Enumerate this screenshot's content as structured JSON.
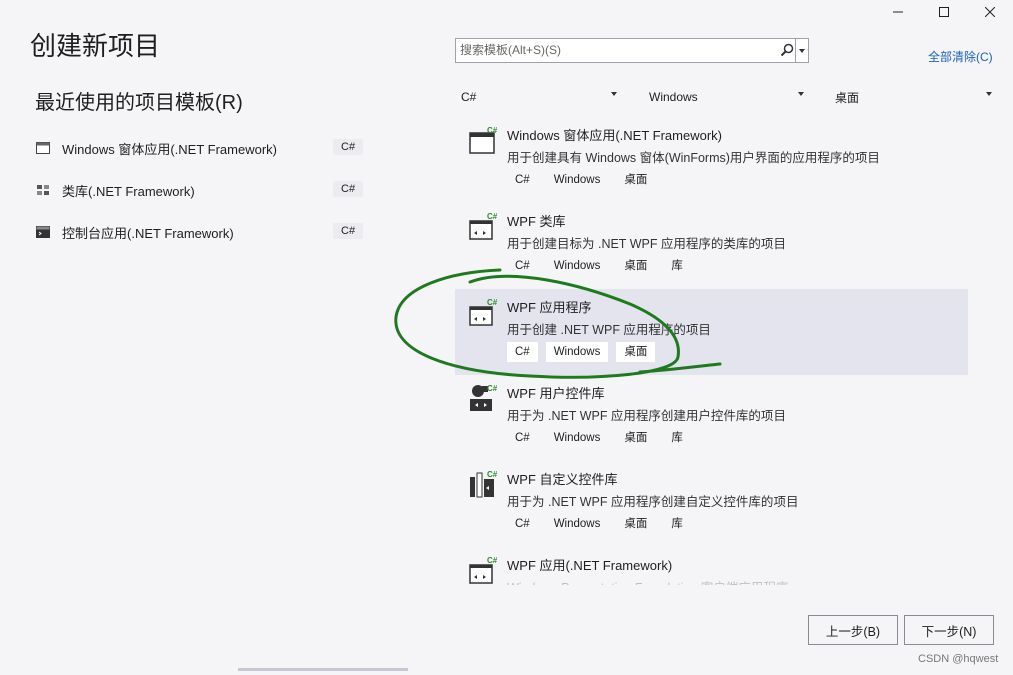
{
  "window": {
    "minimize_icon": "minimize-icon",
    "maximize_icon": "maximize-icon",
    "close_icon": "close-icon"
  },
  "page_title": "创建新项目",
  "recent": {
    "title": "最近使用的项目模板(R)",
    "items": [
      {
        "label": "Windows 窗体应用(.NET Framework)",
        "lang": "C#",
        "icon": "winforms-icon"
      },
      {
        "label": "类库(.NET Framework)",
        "lang": "C#",
        "icon": "class-library-icon"
      },
      {
        "label": "控制台应用(.NET Framework)",
        "lang": "C#",
        "icon": "console-app-icon"
      }
    ]
  },
  "search": {
    "placeholder": "搜索模板(Alt+S)(S)",
    "icon": "search-icon"
  },
  "clear_all": "全部清除(C)",
  "filters": {
    "language": "C#",
    "platform": "Windows",
    "project_type": "桌面"
  },
  "templates": [
    {
      "name": "Windows 窗体应用(.NET Framework)",
      "desc": "用于创建具有 Windows 窗体(WinForms)用户界面的应用程序的项目",
      "tags": [
        "C#",
        "Windows",
        "桌面"
      ]
    },
    {
      "name": "WPF 类库",
      "desc": "用于创建目标为 .NET WPF 应用程序的类库的项目",
      "tags": [
        "C#",
        "Windows",
        "桌面",
        "库"
      ]
    },
    {
      "name": "WPF 应用程序",
      "desc": "用于创建 .NET WPF 应用程序的项目",
      "tags": [
        "C#",
        "Windows",
        "桌面"
      ],
      "selected": true
    },
    {
      "name": "WPF 用户控件库",
      "desc": "用于为 .NET WPF 应用程序创建用户控件库的项目",
      "tags": [
        "C#",
        "Windows",
        "桌面",
        "库"
      ]
    },
    {
      "name": "WPF 自定义控件库",
      "desc": "用于为 .NET WPF 应用程序创建自定义控件库的项目",
      "tags": [
        "C#",
        "Windows",
        "桌面",
        "库"
      ]
    },
    {
      "name": "WPF 应用(.NET Framework)",
      "desc": "Windows Presentation Foundation 客户端应用程序",
      "tags": []
    }
  ],
  "buttons": {
    "back": "上一步(B)",
    "next": "下一步(N)"
  },
  "watermark": "CSDN @hqwest",
  "colors": {
    "accent_link": "#1a62b8",
    "selected_bg": "#e3e4ee",
    "annotation": "#1f7a1f"
  }
}
